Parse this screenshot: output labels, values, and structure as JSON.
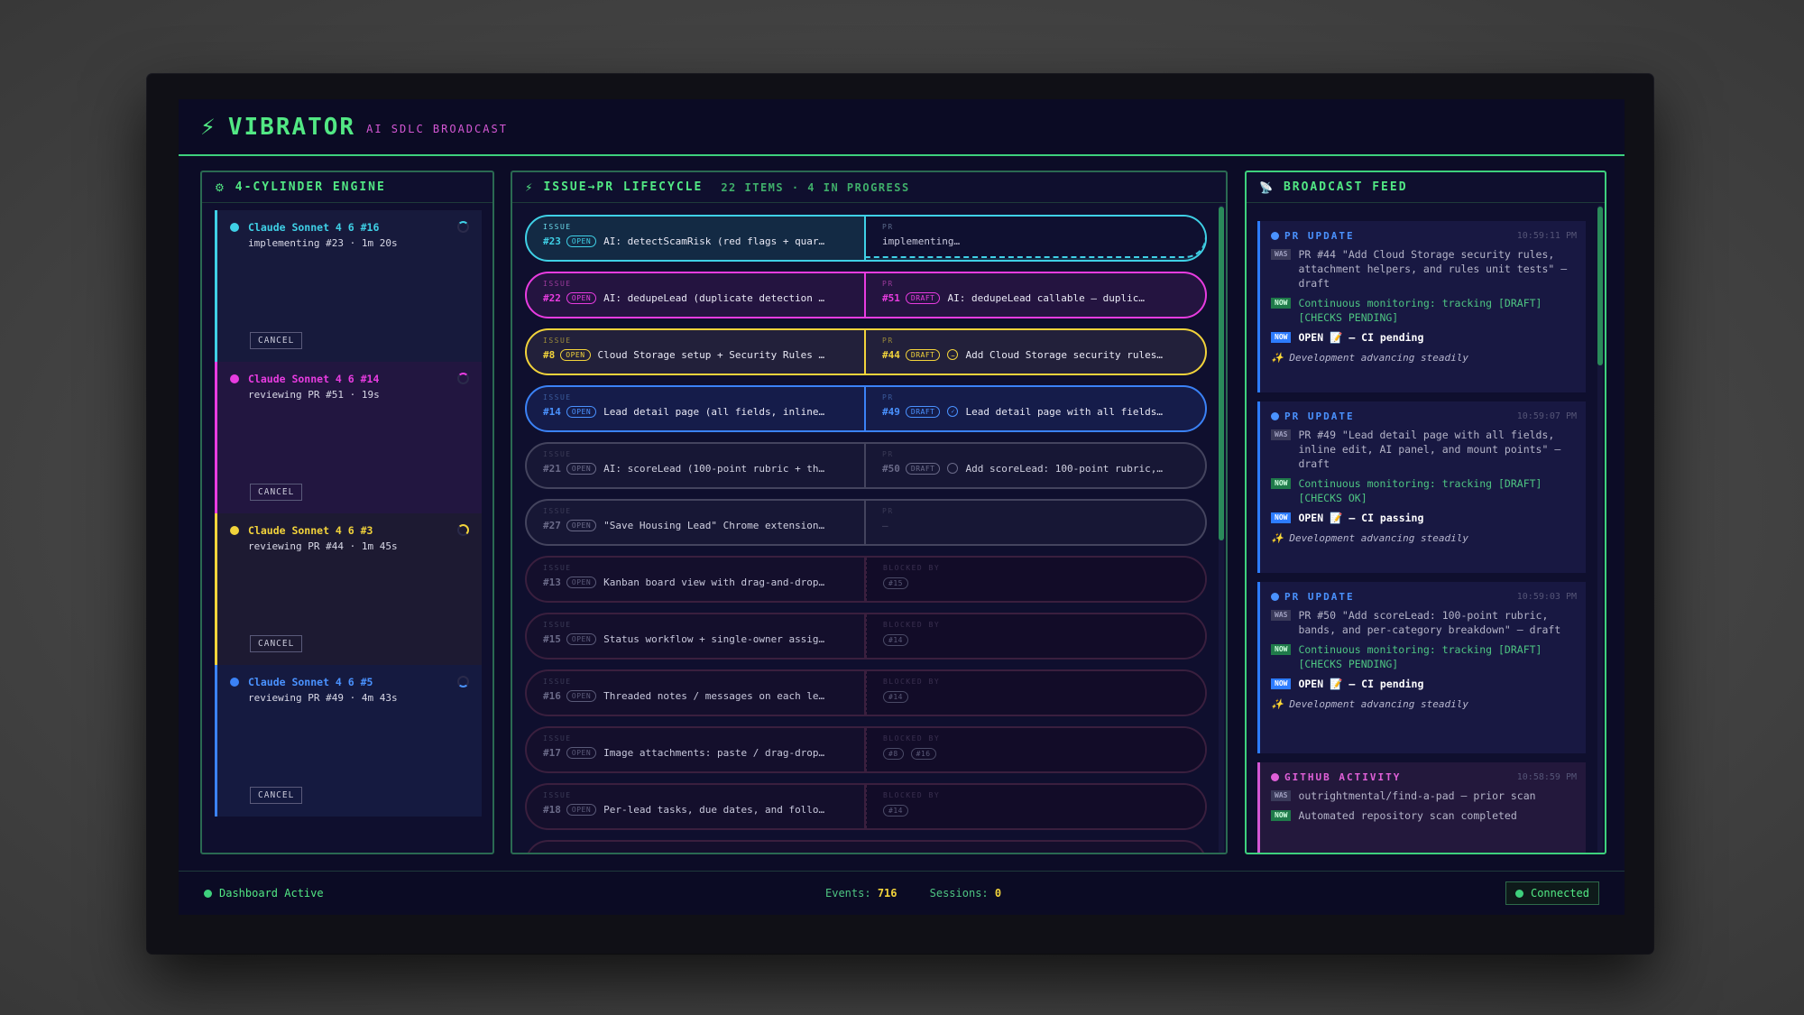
{
  "app": {
    "brand": "VIBRATOR",
    "subtitle": "AI SDLC BROADCAST"
  },
  "engine": {
    "title": "4-CYLINDER ENGINE",
    "cylinders": [
      {
        "name": "Claude Sonnet 4 6 #16",
        "status": "implementing #23 · 1m 20s",
        "cancel": "CANCEL",
        "color": "#3fd0e6"
      },
      {
        "name": "Claude Sonnet 4 6 #14",
        "status": "reviewing PR #51 · 19s",
        "cancel": "CANCEL",
        "color": "#e83ce0"
      },
      {
        "name": "Claude Sonnet 4 6 #3",
        "status": "reviewing PR #44 · 1m 45s",
        "cancel": "CANCEL",
        "color": "#f2d33b"
      },
      {
        "name": "Claude Sonnet 4 6 #5",
        "status": "reviewing PR #49 · 4m 43s",
        "cancel": "CANCEL",
        "color": "#3b82f6"
      }
    ]
  },
  "lifecycle": {
    "title": "ISSUE→PR LIFECYCLE",
    "count": "22 ITEMS · 4 IN PROGRESS",
    "issue_label": "ISSUE",
    "pr_label": "PR",
    "blocked_label": "BLOCKED BY",
    "rows": [
      {
        "issue": "#23",
        "state": "OPEN",
        "title": "AI: detectScamRisk (red flags + quar…",
        "pr_text": "implementing…"
      },
      {
        "issue": "#22",
        "state": "OPEN",
        "title": "AI: dedupeLead (duplicate detection …",
        "pr": "#51",
        "pr_state": "DRAFT",
        "pr_title": "AI: dedupeLead callable — duplicate …"
      },
      {
        "issue": "#8",
        "state": "OPEN",
        "title": "Cloud Storage setup + Security Rules …",
        "pr": "#44",
        "pr_state": "DRAFT",
        "pr_title": "Add Cloud Storage security rules…"
      },
      {
        "issue": "#14",
        "state": "OPEN",
        "title": "Lead detail page (all fields, inline…",
        "pr": "#49",
        "pr_state": "DRAFT",
        "pr_title": "Lead detail page with all fields…"
      },
      {
        "issue": "#21",
        "state": "OPEN",
        "title": "AI: scoreLead (100-point rubric + th…",
        "pr": "#50",
        "pr_state": "DRAFT",
        "pr_title": "Add scoreLead: 100-point rubric,…"
      },
      {
        "issue": "#27",
        "state": "OPEN",
        "title": "\"Save Housing Lead\" Chrome extension…",
        "pr_text": "—"
      },
      {
        "issue": "#13",
        "state": "OPEN",
        "title": "Kanban board view with drag-and-drop…",
        "blocked": [
          "#15"
        ]
      },
      {
        "issue": "#15",
        "state": "OPEN",
        "title": "Status workflow + single-owner assig…",
        "blocked": [
          "#14"
        ]
      },
      {
        "issue": "#16",
        "state": "OPEN",
        "title": "Threaded notes / messages on each le…",
        "blocked": [
          "#14"
        ]
      },
      {
        "issue": "#17",
        "state": "OPEN",
        "title": "Image attachments: paste / drag-drop…",
        "blocked": [
          "#8",
          "#16"
        ]
      },
      {
        "issue": "#18",
        "state": "OPEN",
        "title": "Per-lead tasks, due dates, and follo…",
        "blocked": [
          "#14"
        ]
      }
    ]
  },
  "feed": {
    "title": "BROADCAST FEED",
    "was_tag": "WAS",
    "now_tag": "NOW",
    "cards": [
      {
        "type": "pr",
        "kind": "PR UPDATE",
        "time": "10:59:11 PM",
        "was": "PR #44 \"Add Cloud Storage security rules, attachment helpers, and rules unit tests\" — draft",
        "now": "Continuous monitoring: tracking [DRAFT] [CHECKS PENDING]",
        "open": "OPEN 📝 — CI pending",
        "note": "✨ Development advancing steadily"
      },
      {
        "type": "pr",
        "kind": "PR UPDATE",
        "time": "10:59:07 PM",
        "was": "PR #49 \"Lead detail page with all fields, inline edit, AI panel, and mount points\" — draft",
        "now": "Continuous monitoring: tracking [DRAFT] [CHECKS OK]",
        "open": "OPEN 📝 — CI passing",
        "note": "✨ Development advancing steadily"
      },
      {
        "type": "pr",
        "kind": "PR UPDATE",
        "time": "10:59:03 PM",
        "was": "PR #50 \"Add scoreLead: 100-point rubric, bands, and per-category breakdown\" — draft",
        "now": "Continuous monitoring: tracking [DRAFT] [CHECKS PENDING]",
        "open": "OPEN 📝 — CI pending",
        "note": "✨ Development advancing steadily"
      },
      {
        "type": "gh",
        "kind": "GITHUB ACTIVITY",
        "time": "10:58:59 PM",
        "was": "outrightmental/find-a-pad — prior scan",
        "now": "Automated repository scan completed"
      }
    ]
  },
  "footer": {
    "status": "Dashboard Active",
    "events_label": "Events:",
    "events": "716",
    "sessions_label": "Sessions:",
    "sessions": "0",
    "connection": "Connected"
  },
  "colors": {
    "accent": "#52e884",
    "magenta": "#e83ce0",
    "cyan": "#3fd0e6",
    "yellow": "#f2d33b",
    "blue": "#3b82f6",
    "gray": "#4a4a6a"
  }
}
